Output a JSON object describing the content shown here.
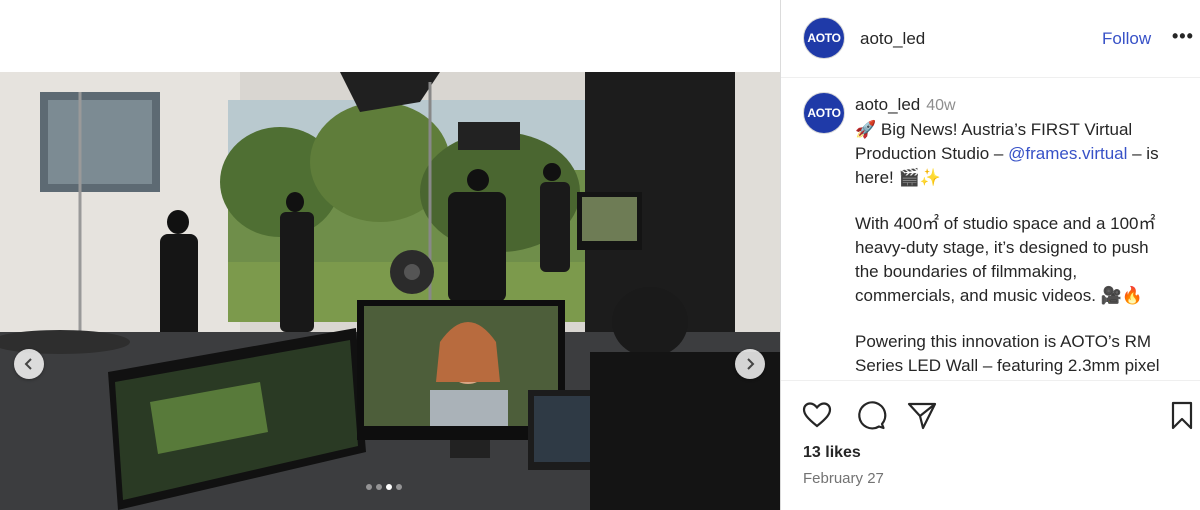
{
  "post": {
    "username": "aoto_led",
    "avatar_text": "AOTO",
    "follow_label": "Follow",
    "more_label": "•••",
    "time_ago": "40w",
    "caption_lines": [
      "🚀 Big News! Austria’s FIRST Virtual",
      "Production Studio – ",
      "@frames.virtual",
      " – is",
      "here! 🎬✨",
      "With 400㎡ of studio space and a 100㎡",
      "heavy-duty stage, it’s designed to push",
      "the boundaries of filmmaking,",
      "commercials, and music videos. 🎥🔥",
      "Powering this innovation is AOTO’s RM",
      "Series LED Wall – featuring 2.3mm pixel"
    ],
    "likes": "13 likes",
    "date": "February 27"
  },
  "carousel": {
    "prev_icon": "chevron-left-icon",
    "next_icon": "chevron-right-icon",
    "slide_count": 4,
    "active_index": 2
  },
  "icons": {
    "like": "heart-icon",
    "comment": "comment-icon",
    "share": "send-icon",
    "save": "bookmark-icon"
  },
  "colors": {
    "brand_avatar": "#1f3aa8",
    "link": "#3751c7",
    "text": "#262626",
    "muted": "#737373"
  }
}
